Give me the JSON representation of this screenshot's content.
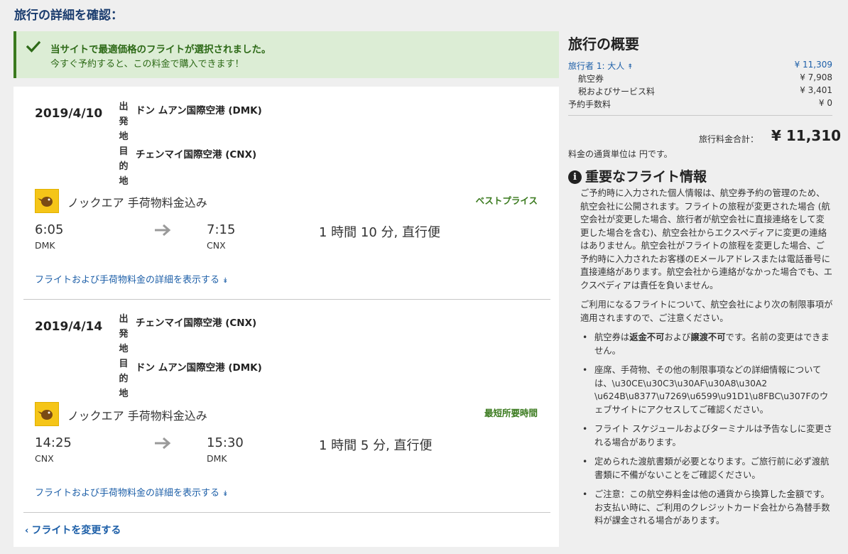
{
  "page_title": "旅行の詳細を確認：",
  "banner": {
    "line1": "当サイトで最適価格のフライトが選択されました。",
    "line2": "今すぐ予約すると、この料金で購入できます！"
  },
  "labels": {
    "departure": [
      "出",
      "発",
      "地"
    ],
    "arrival": [
      "目",
      "的",
      "地"
    ]
  },
  "legs": [
    {
      "date": "2019/4/10",
      "from_airport": "ドン ムアン国際空港 (DMK)",
      "to_airport": "チェンマイ国際空港 (CNX)",
      "airline": "ノックエア 手荷物料金込み",
      "badge": "ベストプライス",
      "dep_time": "6:05",
      "dep_code": "DMK",
      "arr_time": "7:15",
      "arr_code": "CNX",
      "duration": "1 時間 10 分, 直行便",
      "details_link": "フライトおよび手荷物料金の詳細を表示する"
    },
    {
      "date": "2019/4/14",
      "from_airport": "チェンマイ国際空港 (CNX)",
      "to_airport": "ドン ムアン国際空港 (DMK)",
      "airline": "ノックエア 手荷物料金込み",
      "badge": "最短所要時間",
      "dep_time": "14:25",
      "dep_code": "CNX",
      "arr_time": "15:30",
      "arr_code": "DMK",
      "duration": "1 時間 5 分, 直行便",
      "details_link": "フライトおよび手荷物料金の詳細を表示する"
    }
  ],
  "change_flight": "フライトを変更する",
  "summary": {
    "title": "旅行の概要",
    "traveler_label": "旅行者 1: 大人",
    "traveler_value": "¥ 11,309",
    "airfare_label": "航空券",
    "airfare_value": "¥ 7,908",
    "tax_label": "税およびサービス料",
    "tax_value": "¥ 3,401",
    "booking_fee_label": "予約手数料",
    "booking_fee_value": "¥ 0",
    "total_label": "旅行料金合計：",
    "total_value": "¥ 11,310",
    "currency_note": "料金の通貨単位は 円です。"
  },
  "info": {
    "title": "重要なフライト情報",
    "para1": "ご予約時に入力された個人情報は、航空券予約の管理のため、航空会社に公開されます。フライトの旅程が変更された場合 (航空会社が変更した場合、旅行者が航空会社に直接連絡をして変更した場合を含む)、航空会社からエクスペディアに変更の連絡はありません。航空会社がフライトの旅程を変更した場合、ご予約時に入力されたお客様のEメールアドレスまたは電話番号に直接連絡があります。航空会社から連絡がなかった場合でも、エクスペディアは責任を負いません。",
    "para2": "ご利用になるフライトについて、航空会社により次の制限事項が適用されますので、ご注意ください。",
    "bullet1_a": "航空券は",
    "bullet1_b": "返金不可",
    "bullet1_c": "および",
    "bullet1_d": "譲渡不可",
    "bullet1_e": "です。名前の変更はできません。",
    "bullet2": "座席、手荷物、その他の制限事項などの詳細情報については、\\u30CE\\u30C3\\u30AF\\u30A8\\u30A2 \\u624B\\u8377\\u7269\\u6599\\u91D1\\u8FBC\\u307Fのウェブサイトにアクセスしてご確認ください。",
    "bullet3": "フライト スケジュールおよびターミナルは予告なしに変更される場合があります。",
    "bullet4": "定められた渡航書類が必要となります。ご旅行前に必ず渡航書類に不備がないことをご確認ください。",
    "bullet5": "ご注意：この航空券料金は他の通貨から換算した金額です。お支払い時に、ご利用のクレジットカード会社から為替手数料が課金される場合があります。"
  },
  "colors": {
    "accent_blue": "#1d5fa8",
    "success_green": "#3a7a1e",
    "banner_bg": "#dcedd5"
  }
}
